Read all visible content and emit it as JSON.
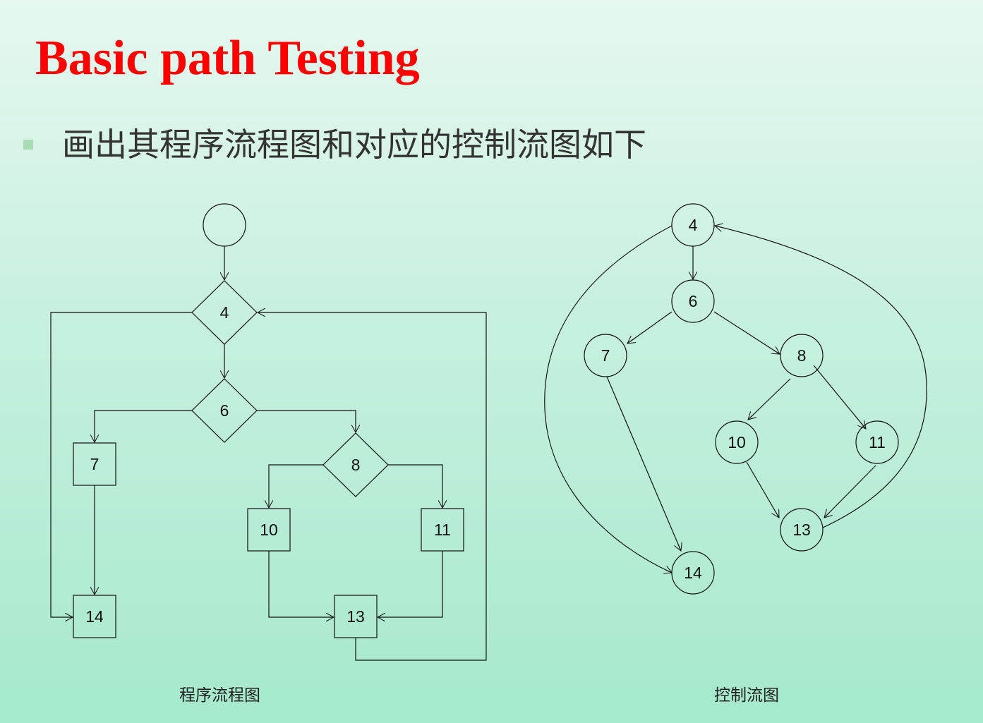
{
  "title": "Basic path Testing",
  "subtitle": "画出其程序流程图和对应的控制流图如下",
  "flowchart": {
    "caption": "程序流程图",
    "nodes": {
      "n4": "4",
      "n6": "6",
      "n7": "7",
      "n8": "8",
      "n10": "10",
      "n11": "11",
      "n13": "13",
      "n14": "14"
    }
  },
  "control_flow_graph": {
    "caption": "控制流图",
    "nodes": {
      "n4": "4",
      "n6": "6",
      "n7": "7",
      "n8": "8",
      "n10": "10",
      "n11": "11",
      "n13": "13",
      "n14": "14"
    },
    "edges": [
      [
        "4",
        "6"
      ],
      [
        "6",
        "7"
      ],
      [
        "6",
        "8"
      ],
      [
        "8",
        "10"
      ],
      [
        "8",
        "11"
      ],
      [
        "10",
        "13"
      ],
      [
        "11",
        "13"
      ],
      [
        "7",
        "14"
      ],
      [
        "13",
        "4"
      ],
      [
        "4",
        "14"
      ]
    ]
  }
}
